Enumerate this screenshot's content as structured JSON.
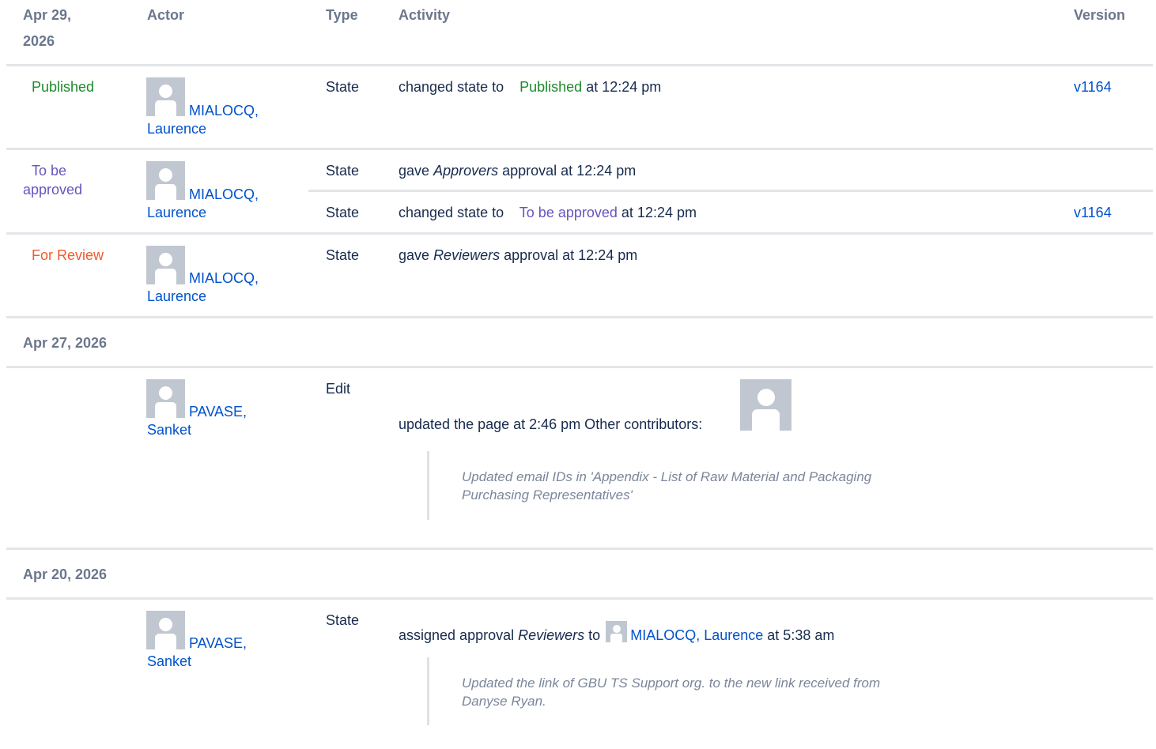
{
  "header": {
    "date_line1": "Apr 29,",
    "date_line2": "2026",
    "actor": "Actor",
    "type": "Type",
    "activity": "Activity",
    "version": "Version"
  },
  "groups": [
    {
      "state": "Published",
      "actor_line1": "MIALOCQ,",
      "actor_line2": "Laurence",
      "entries": [
        {
          "type": "State",
          "pre": "changed state to",
          "state": "Published",
          "post": "at 12:24 pm",
          "version": "v1164"
        }
      ]
    },
    {
      "state_line1": "To be",
      "state_line2": "approved",
      "actor_line1": "MIALOCQ,",
      "actor_line2": "Laurence",
      "entries": [
        {
          "type": "State",
          "pre": "gave",
          "em": "Approvers",
          "post": "approval at 12:24 pm"
        },
        {
          "type": "State",
          "pre": "changed state to",
          "state": "To be approved",
          "post": "at 12:24 pm",
          "version": "v1164"
        }
      ]
    },
    {
      "state": "For Review",
      "actor_line1": "MIALOCQ,",
      "actor_line2": "Laurence",
      "entries": [
        {
          "type": "State",
          "pre": "gave",
          "em": "Reviewers",
          "post": "approval at 12:24 pm"
        }
      ]
    }
  ],
  "day2": {
    "date": "Apr 27, 2026",
    "actor_line1": "PAVASE,",
    "actor_line2": "Sanket",
    "type": "Edit",
    "activity": "updated the page at 2:46 pm Other contributors:",
    "comment": "Updated email IDs in 'Appendix - List of Raw Material and Packaging Purchasing Representatives'"
  },
  "day3": {
    "date": "Apr 20, 2026",
    "actor_line1": "PAVASE,",
    "actor_line2": "Sanket",
    "type": "State",
    "pre": "assigned approval",
    "em": "Reviewers",
    "to": "to",
    "assignee": "MIALOCQ, Laurence",
    "post": "at 5:38 am",
    "comment": "Updated the link of GBU TS Support org. to the new link received from Danyse Ryan."
  },
  "colors": {
    "link": "#0052cc",
    "published": "#1c8a2b",
    "to_be_approved": "#6554c0",
    "for_review": "#f25a2b",
    "header": "#6b778c"
  },
  "icons": [
    "user-avatar-icon"
  ]
}
